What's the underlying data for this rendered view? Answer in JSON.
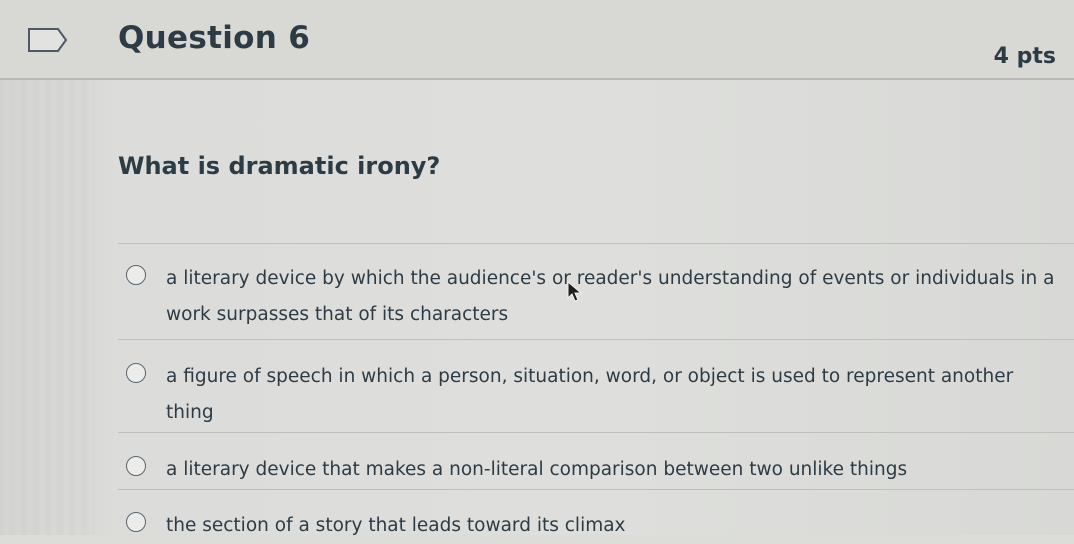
{
  "question": {
    "title": "Question 6",
    "points": "4 pts",
    "prompt": "What is dramatic irony?"
  },
  "answers": [
    {
      "text": "a literary device by which the audience's or reader's understanding of events or individuals in a work surpasses that of its characters",
      "selected": false
    },
    {
      "text": "a figure of speech in which a person, situation, word, or object is used to represent another thing",
      "selected": false
    },
    {
      "text": "a literary device that makes a non-literal comparison between two unlike things",
      "selected": false
    },
    {
      "text": "the section of a story that leads toward its climax",
      "selected": false
    }
  ],
  "icons": {
    "flag": "flag-outline-icon",
    "cursor": "mouse-pointer-icon"
  },
  "colors": {
    "text": "#2d3b45",
    "background": "#dcdcd9",
    "divider": "#bfc0bc"
  }
}
